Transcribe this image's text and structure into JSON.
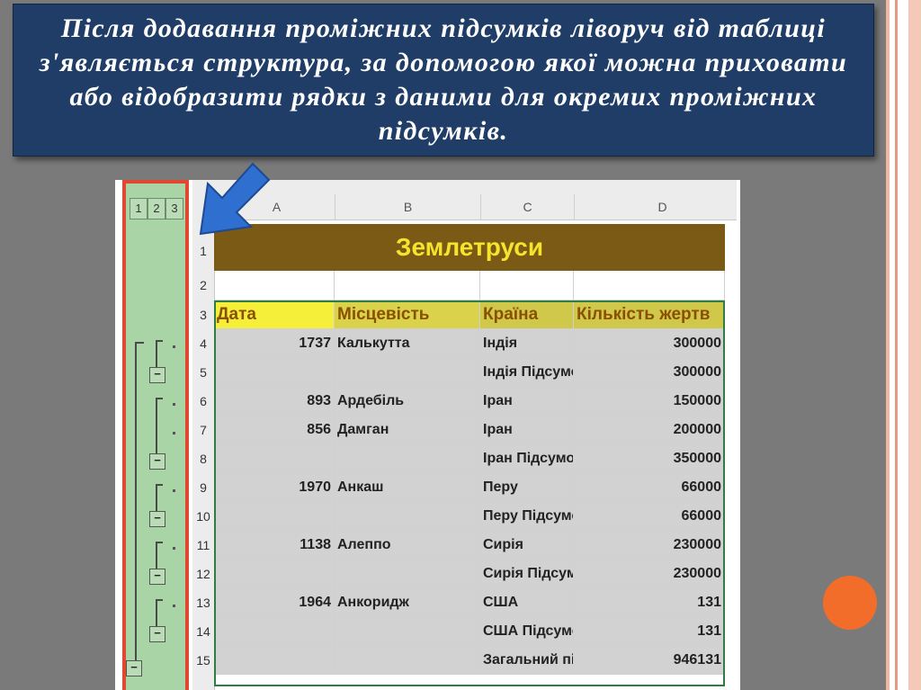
{
  "caption": "Після додавання проміжних підсумків ліворуч від таблиці з'являється структура, за допомогою якої можна приховати або відобразити рядки з даними для окремих проміжних підсумків.",
  "outline_levels": [
    "1",
    "2",
    "3"
  ],
  "outline_collapse_glyph": "−",
  "columns": [
    "A",
    "B",
    "C",
    "D"
  ],
  "row_numbers": [
    "1",
    "2",
    "3",
    "4",
    "5",
    "6",
    "7",
    "8",
    "9",
    "10",
    "11",
    "12",
    "13",
    "14",
    "15"
  ],
  "sheet_title": "Землетруси",
  "headers": [
    "Дата",
    "Місцевість",
    "Країна",
    "Кількість жертв"
  ],
  "rows": [
    [
      "1737",
      "Калькутта",
      "Індія",
      "300000"
    ],
    [
      "",
      "",
      "Індія Підсумо",
      "300000"
    ],
    [
      "893",
      "Ардебіль",
      "Іран",
      "150000"
    ],
    [
      "856",
      "Дамган",
      "Іран",
      "200000"
    ],
    [
      "",
      "",
      "Іран Підсумо",
      "350000"
    ],
    [
      "1970",
      "Анкаш",
      "Перу",
      "66000"
    ],
    [
      "",
      "",
      "Перу Підсумо",
      "66000"
    ],
    [
      "1138",
      "Алеппо",
      "Сирія",
      "230000"
    ],
    [
      "",
      "",
      "Сирія Підсум",
      "230000"
    ],
    [
      "1964",
      "Анкоридж",
      "США",
      "131"
    ],
    [
      "",
      "",
      "США Підсумо",
      "131"
    ],
    [
      "",
      "",
      "Загальний під",
      "946131"
    ]
  ],
  "colors": {
    "caption_bg": "#1f3d66",
    "outline_panel": "#a9d4a5",
    "highlight_border": "#e2482f",
    "title_bg": "#7b5a16",
    "title_text": "#f6e42c",
    "header_bg": "#f2ea1a",
    "arrow": "#2f6fd0",
    "accent_dot": "#f26d2a"
  }
}
